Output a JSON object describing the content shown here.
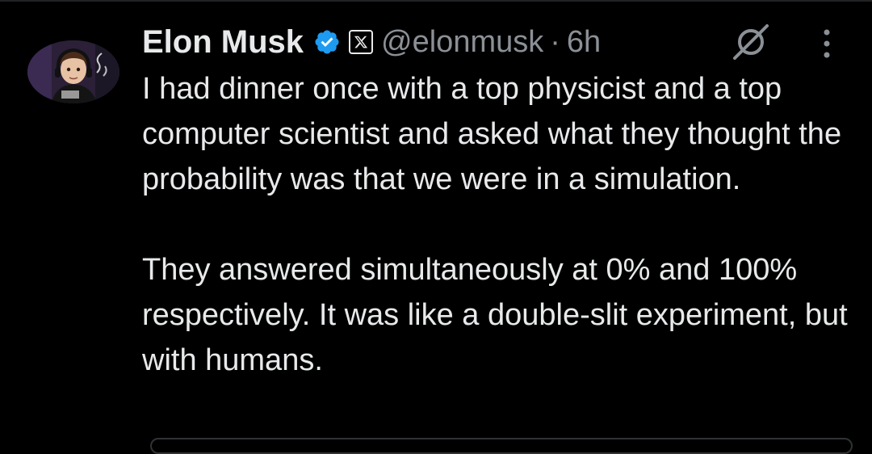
{
  "author": {
    "display_name": "Elon Musk",
    "handle": "@elonmusk",
    "separator": "·",
    "timestamp": "6h",
    "verified_icon": "verified-badge-icon",
    "affiliation_icon": "x-logo-icon"
  },
  "actions": {
    "grok_icon": "grok-icon",
    "more_icon": "more-vertical-icon"
  },
  "tweet": {
    "paragraphs": [
      "I had dinner once with a top physicist and a top computer scientist and asked what they thought the probability was that we were in a simulation.",
      "They answered simultaneously at 0% and 100% respectively. It was like a double-slit experiment, but with humans."
    ]
  },
  "colors": {
    "background": "#000000",
    "text": "#e7e9ea",
    "secondary_text": "#8b9096",
    "verified_blue": "#1d9bf0"
  }
}
